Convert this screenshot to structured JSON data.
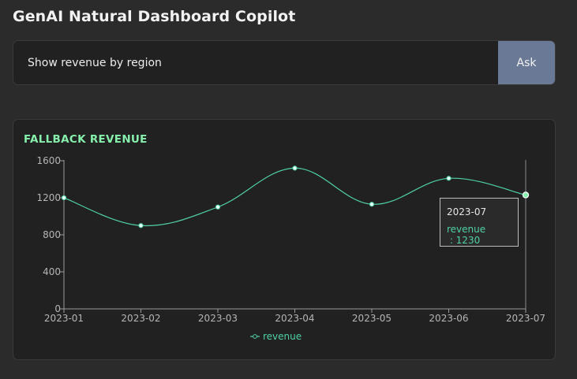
{
  "app": {
    "title": "GenAI Natural Dashboard Copilot"
  },
  "query": {
    "value": "Show revenue by region",
    "button_label": "Ask"
  },
  "chart": {
    "title": "FALLBACK REVENUE"
  },
  "colors": {
    "accent_green": "#86efac",
    "series_line": "#4fd1a5",
    "button_bg": "#6a7a96"
  },
  "tooltip": {
    "date": "2023-07",
    "series_name": "revenue",
    "separator": " : ",
    "value": "1230"
  },
  "chart_data": {
    "type": "line",
    "title": "FALLBACK REVENUE",
    "categories": [
      "2023-01",
      "2023-02",
      "2023-03",
      "2023-04",
      "2023-05",
      "2023-06",
      "2023-07"
    ],
    "series": [
      {
        "name": "revenue",
        "values": [
          1200,
          900,
          1100,
          1520,
          1130,
          1410,
          1230
        ]
      }
    ],
    "yticks": [
      "0",
      "400",
      "800",
      "1200",
      "1600"
    ],
    "ylim": [
      0,
      1600
    ],
    "curve": "smooth",
    "grid": false,
    "legend": "bottom-center",
    "hover_category": "2023-07"
  }
}
